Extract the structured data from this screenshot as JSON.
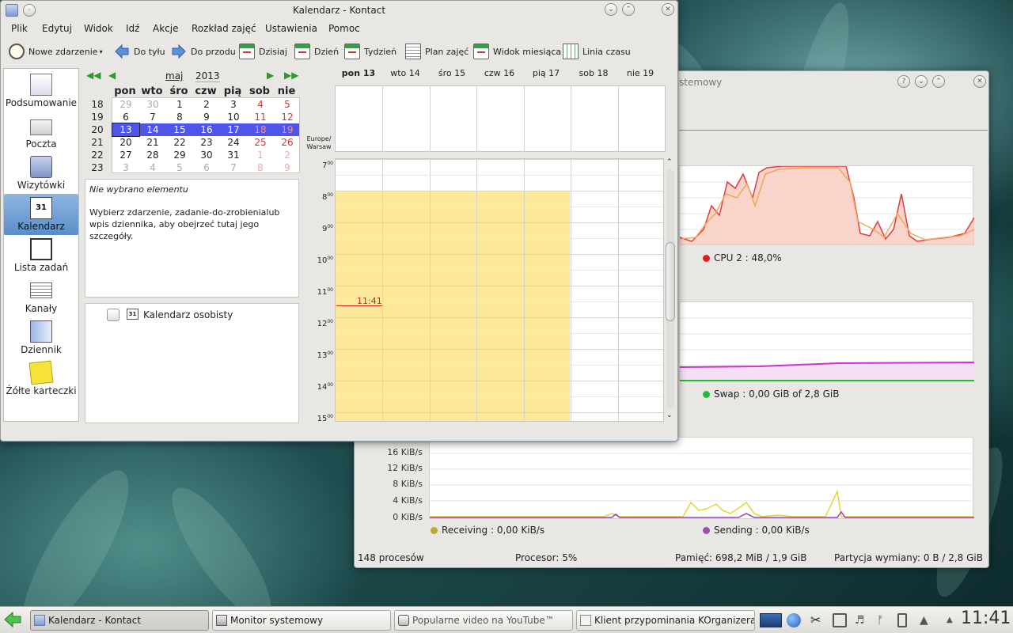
{
  "kontact": {
    "title": "Kalendarz - Kontact",
    "menu": [
      "Plik",
      "Edytuj",
      "Widok",
      "Idź",
      "Akcje",
      "Rozkład zajęć",
      "Ustawienia",
      "Pomoc"
    ],
    "toolbar": {
      "new_event": "Nowe zdarzenie",
      "back": "Do tyłu",
      "forward": "Do przodu",
      "today": "Dzisiaj",
      "day": "Dzień",
      "week": "Tydzień",
      "schedule": "Plan zajęć",
      "month_view": "Widok miesiąca",
      "timeline": "Linia czasu"
    },
    "sidebar": [
      {
        "label": "Podsumowanie",
        "icon": "summary-icon"
      },
      {
        "label": "Poczta",
        "icon": "mail-icon"
      },
      {
        "label": "Wizytówki",
        "icon": "contacts-icon"
      },
      {
        "label": "Kalendarz",
        "icon": "calendar-icon",
        "active": true
      },
      {
        "label": "Lista zadań",
        "icon": "todo-icon"
      },
      {
        "label": "Kanały",
        "icon": "feeds-icon"
      },
      {
        "label": "Dziennik",
        "icon": "journal-icon"
      },
      {
        "label": "Żółte karteczki",
        "icon": "notes-icon"
      }
    ],
    "minical": {
      "month": "maj",
      "year": "2013",
      "weekdays": [
        "pon",
        "wto",
        "śro",
        "czw",
        "pią",
        "sob",
        "nie"
      ],
      "weeks": [
        "18",
        "19",
        "20",
        "21",
        "22",
        "23"
      ],
      "rows": [
        [
          "29",
          "30",
          "1",
          "2",
          "3",
          "4",
          "5"
        ],
        [
          "6",
          "7",
          "8",
          "9",
          "10",
          "11",
          "12"
        ],
        [
          "13",
          "14",
          "15",
          "16",
          "17",
          "18",
          "19"
        ],
        [
          "20",
          "21",
          "22",
          "23",
          "24",
          "25",
          "26"
        ],
        [
          "27",
          "28",
          "29",
          "30",
          "31",
          "1",
          "2"
        ],
        [
          "3",
          "4",
          "5",
          "6",
          "7",
          "8",
          "9"
        ]
      ],
      "selected_row": 2
    },
    "details": {
      "title": "Nie wybrano elementu",
      "body": "Wybierz zdarzenie, zadanie-do-zrobienialub wpis dziennika, aby obejrzeć tutaj jego szczegóły."
    },
    "calendars": {
      "item": "Kalendarz osobisty",
      "icon_text": "31"
    },
    "agenda": {
      "days": [
        "pon 13",
        "wto 14",
        "śro 15",
        "czw 16",
        "pią 17",
        "sob 18",
        "nie 19"
      ],
      "timezone": "Europe/ Warsaw",
      "hours": [
        "7",
        "8",
        "9",
        "10",
        "11",
        "12",
        "13",
        "14",
        "15"
      ],
      "minutes_suffix": "00",
      "current_time": "11:41"
    },
    "colors": {
      "work_hours": "#fde99b",
      "selection": "#4f55e8",
      "now_line": "#cc2222",
      "weekend_text": "#e03030"
    }
  },
  "monitor": {
    "title": "Monitor systemowy",
    "title_visible": "stemowy",
    "cpu_legend": "CPU 2 : 48,0%",
    "swap_legend": "Swap : 0,00 GiB of 2,8 GiB",
    "net_axis": [
      "16 KiB/s",
      "12 KiB/s",
      "8 KiB/s",
      "4 KiB/s",
      "0 KiB/s"
    ],
    "receiving": "Receiving : 0,00 KiB/s",
    "sending": "Sending : 0,00 KiB/s",
    "status": {
      "processes": "148 procesów",
      "cpu": "Procesor: 5%",
      "memory": "Pamięć: 698,2 MiB / 1,9 GiB",
      "swap": "Partycja wymiany: 0 B / 2,8 GiB"
    }
  },
  "taskbar": {
    "tasks": [
      {
        "label": "Kalendarz - Kontact",
        "active": true
      },
      {
        "label": "Monitor systemowy",
        "active": false
      },
      {
        "label": "Popularne video na YouTube™",
        "active": false
      },
      {
        "label": "Klient przypominania KOrganizera",
        "active": false
      }
    ],
    "clock": "11:41"
  }
}
